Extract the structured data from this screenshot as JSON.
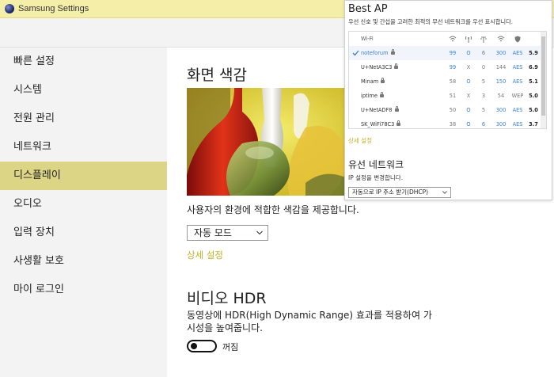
{
  "window": {
    "title": "Samsung Settings"
  },
  "sidebar": {
    "items": [
      {
        "label": "빠른 설정"
      },
      {
        "label": "시스템"
      },
      {
        "label": "전원 관리"
      },
      {
        "label": "네트워크"
      },
      {
        "label": "디스플레이",
        "active": true
      },
      {
        "label": "오디오"
      },
      {
        "label": "입력 장치"
      },
      {
        "label": "사생활 보호"
      },
      {
        "label": "마이 로그인"
      }
    ]
  },
  "display": {
    "color_title": "화면 색감",
    "color_desc": "사용자의 환경에 적합한 색감을 제공합니다.",
    "color_mode": "자동 모드",
    "detail_link": "상세 설정",
    "hdr_title": "비디오 HDR",
    "hdr_desc": "동영상에 HDR(High Dynamic Range) 효과를 적용하여 가시성을 높여줍니다.",
    "hdr_state": "꺼짐"
  },
  "best_ap": {
    "title": "Best AP",
    "subtitle": "우선 신호 및 간섭을 고려한 최적의 무선 네트워크를 우선 표시합니다.",
    "columns": [
      "Wi-Fi",
      "wifi-signal-icon",
      "antenna-icon",
      "interference-icon",
      "speed-wifi-icon",
      "shield-icon"
    ],
    "rows": [
      {
        "name": "noteforum",
        "signal": "99",
        "channel": "O",
        "interference": "6",
        "speed": "300",
        "enc": "AES",
        "score": "5.9",
        "selected": true
      },
      {
        "name": "U+NetA3C3",
        "signal": "99",
        "channel": "X",
        "interference": "0",
        "speed": "144",
        "enc": "AES",
        "score": "6.9"
      },
      {
        "name": "Minam",
        "signal": "58",
        "channel": "O",
        "interference": "5",
        "speed": "150",
        "enc": "AES",
        "score": "5.1"
      },
      {
        "name": "iptime",
        "signal": "51",
        "channel": "X",
        "interference": "3",
        "speed": "54",
        "enc": "WEP",
        "score": "5.0"
      },
      {
        "name": "U+NetADF8",
        "signal": "50",
        "channel": "O",
        "interference": "5",
        "speed": "300",
        "enc": "AES",
        "score": "5.0"
      },
      {
        "name": "SK_WiFi78C3",
        "signal": "38",
        "channel": "O",
        "interference": "6",
        "speed": "300",
        "enc": "AES",
        "score": "3.7"
      }
    ],
    "detail_link": "상세 설정",
    "wired_title": "유선 네트워크",
    "wired_desc": "IP 설정을 변경합니다.",
    "ip_mode": "자동으로 IP 주소 받기(DHCP)"
  },
  "colors": {
    "accent": "#dcd586",
    "titlebar": "#f5eea8",
    "link": "#c2b22b",
    "blue": "#3a7fd0"
  }
}
